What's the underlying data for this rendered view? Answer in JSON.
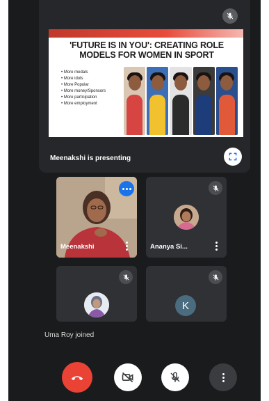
{
  "presentation": {
    "slide_title_line1": "'FUTURE IS IN YOU': CREATING ROLE",
    "slide_title_line2": "MODELS FOR WOMEN IN SPORT",
    "bullets": [
      "More medals",
      "More idols",
      "More Popular",
      "More money/Sponsors",
      "More participation",
      "More employment"
    ],
    "presenter_text": "Meenakshi is presenting"
  },
  "participants": {
    "p1": {
      "name": "Meenakshi"
    },
    "p2": {
      "name": "Ananya Si..."
    },
    "p4": {
      "initial": "K"
    }
  },
  "notification": "Uma Roy joined",
  "colors": {
    "end_call": "#ea4335",
    "speaking": "#1a73e8",
    "background": "#1a1b1d"
  }
}
